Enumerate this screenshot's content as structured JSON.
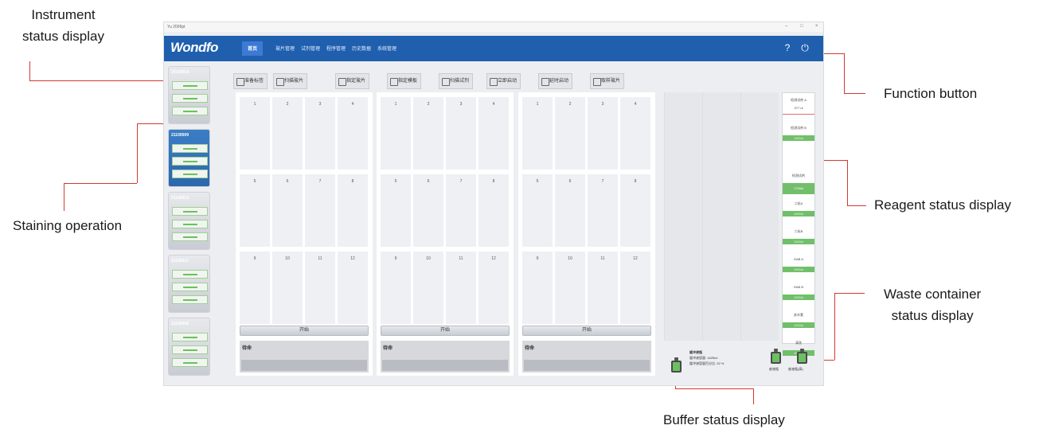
{
  "annotations": {
    "instrument_status": [
      "Instrument",
      "status display"
    ],
    "staining_operation": "Staining operation",
    "function_button": "Function button",
    "reagent_status": "Reagent status display",
    "waste_container": [
      "Waste container",
      "status display"
    ],
    "buffer_status": "Buffer status display"
  },
  "app": {
    "window_title": "Yu 2006pt",
    "window_controls": [
      "–",
      "□",
      "×"
    ],
    "logo": "Wondfo",
    "menu": [
      "首页",
      "玻片管理",
      "试剂管理",
      "程序管理",
      "历史数据",
      "系统管理"
    ],
    "help_icon": "question-icon",
    "exit_icon": "power-icon"
  },
  "instruments": [
    {
      "id": "20100014",
      "selected": false
    },
    {
      "id": "21100009",
      "selected": true
    },
    {
      "id": "21100013",
      "selected": false
    },
    {
      "id": "21100012",
      "selected": false
    },
    {
      "id": "21100008",
      "selected": false
    }
  ],
  "toolbar": [
    "准备标签",
    "扫描玻片",
    "指定玻片",
    "指定模板",
    "扫描试剂",
    "立即启动",
    "延时启动",
    "取样玻片"
  ],
  "panels": [
    {
      "cells": [
        "1",
        "2",
        "3",
        "4",
        "5",
        "6",
        "7",
        "8",
        "9",
        "10",
        "11",
        "12"
      ],
      "start_label": "开始",
      "status": "待命"
    },
    {
      "cells": [
        "1",
        "2",
        "3",
        "4",
        "5",
        "6",
        "7",
        "8",
        "9",
        "10",
        "11",
        "12"
      ],
      "start_label": "开始",
      "status": "待命"
    },
    {
      "cells": [
        "1",
        "2",
        "3",
        "4",
        "5",
        "6",
        "7",
        "8",
        "9",
        "10",
        "11",
        "12"
      ],
      "start_label": "开始",
      "status": "待命"
    }
  ],
  "reagents": {
    "items": [
      {
        "name": "检测试剂 A",
        "value": "377 ul"
      },
      {
        "name": "检测试剂 B",
        "value": "1000ul"
      },
      {
        "name": "检测试剂",
        "value": "1728ul"
      },
      {
        "name": "二抗A",
        "value": "1000ul"
      },
      {
        "name": "二抗B",
        "value": "1000ul"
      },
      {
        "name": "DAB A",
        "value": "1000ul"
      },
      {
        "name": "DAB B",
        "value": "1000ul"
      },
      {
        "name": "苏木素",
        "value": "1000ul"
      },
      {
        "name": "清洗",
        "value": "1000ul"
      }
    ]
  },
  "buffer": {
    "title": "缓冲液瓶",
    "capacity_label": "缓冲液容量:",
    "capacity_value": "1625ml",
    "ratio_label": "缓冲液容量百分比:",
    "ratio_value": "32 %"
  },
  "waste": {
    "labels": [
      "废液瓶",
      "废液瓶(高)"
    ]
  },
  "colors": {
    "menubar": "#1f5fae",
    "selected_instrument": "#2c67ad",
    "ok_green": "#71bf6a",
    "annotation_line": "#d23a2e"
  }
}
